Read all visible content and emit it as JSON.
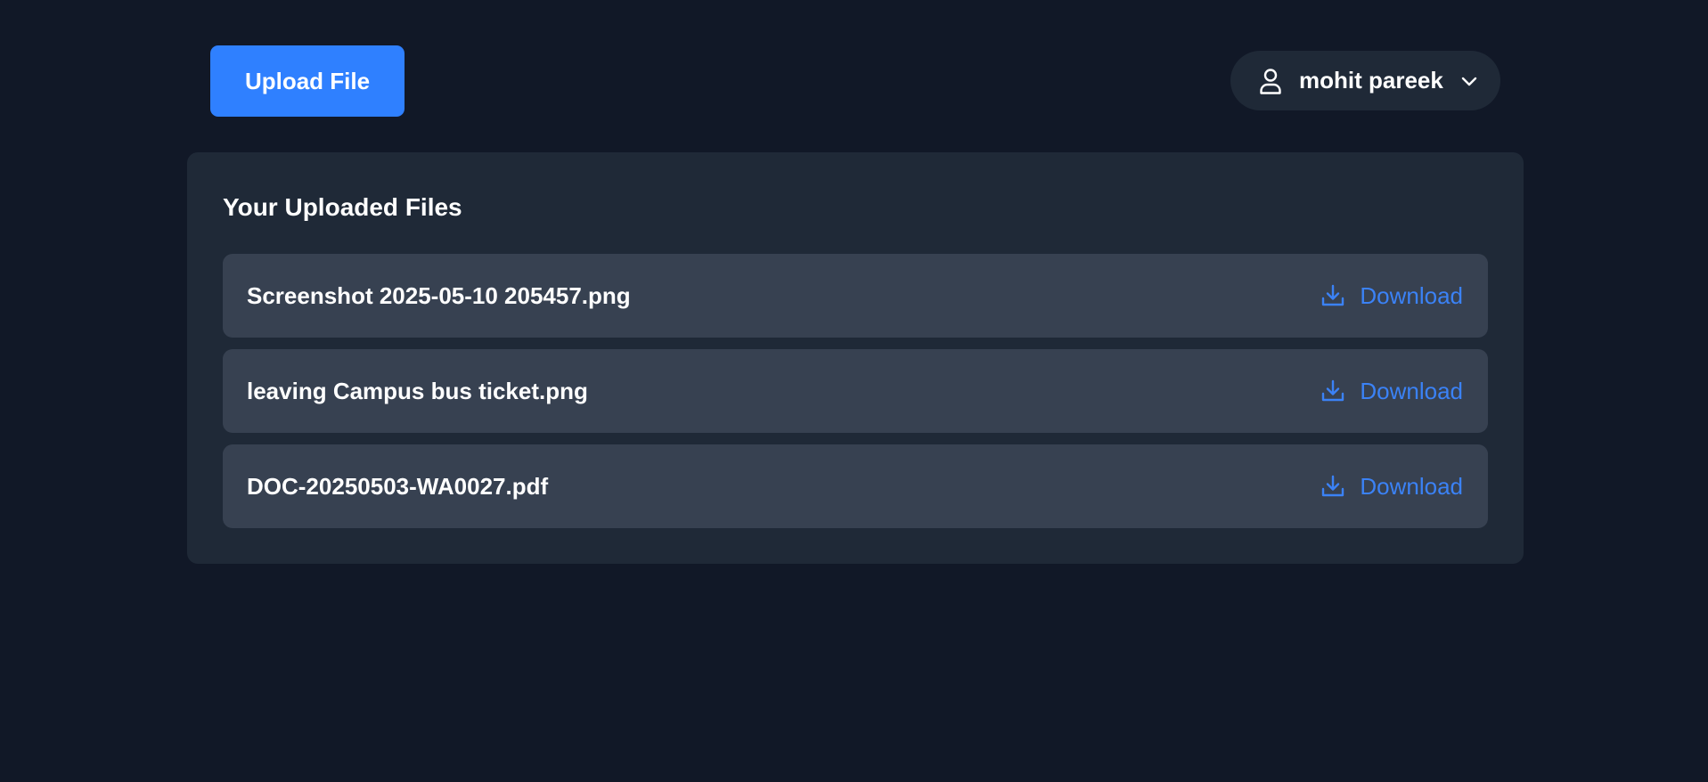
{
  "header": {
    "upload_label": "Upload File",
    "user": {
      "name": "mohit pareek",
      "icon": "user-icon",
      "menu_icon": "chevron-down-icon"
    }
  },
  "files_panel": {
    "title": "Your Uploaded Files",
    "download_icon": "download-icon",
    "files": [
      {
        "name": "Screenshot 2025-05-10 205457.png",
        "action": "Download"
      },
      {
        "name": "leaving Campus bus ticket.png",
        "action": "Download"
      },
      {
        "name": "DOC-20250503-WA0027.pdf",
        "action": "Download"
      }
    ]
  },
  "colors": {
    "background": "#111827",
    "panel": "#1f2937",
    "row": "#374151",
    "accent": "#2f80ff",
    "link": "#3b82f6",
    "text": "#ffffff"
  }
}
